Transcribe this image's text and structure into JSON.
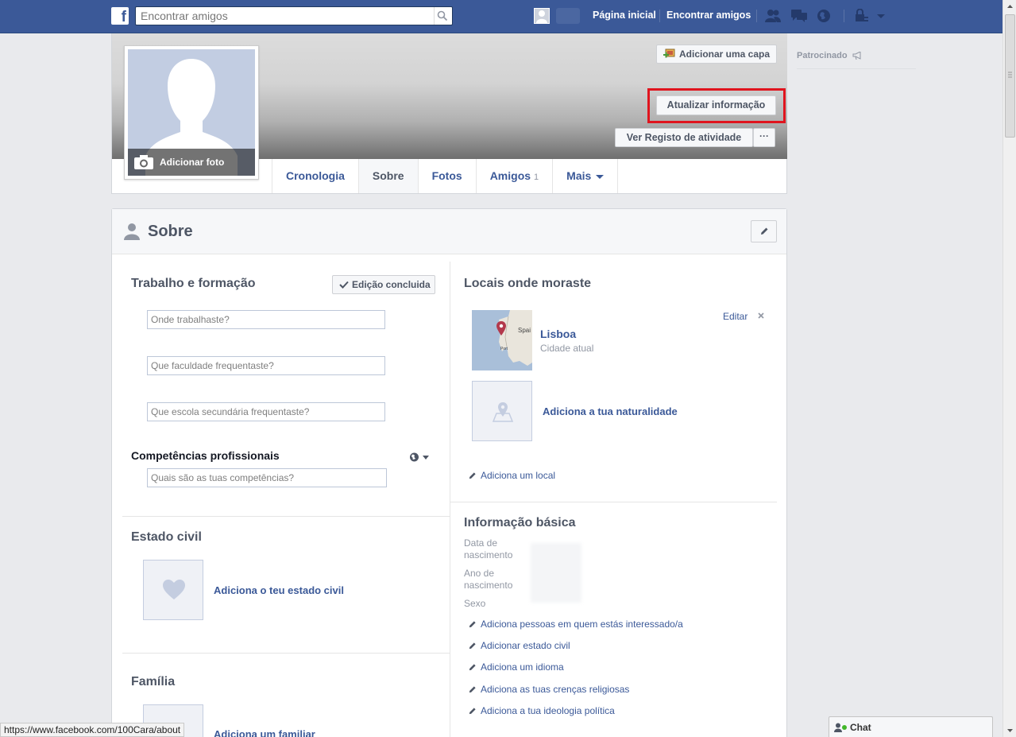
{
  "topbar": {
    "search_placeholder": "Encontrar amigos",
    "nav_home": "Página inicial",
    "nav_find_friends": "Encontrar amigos"
  },
  "cover": {
    "add_cover_label": "Adicionar uma capa",
    "update_info_label": "Atualizar informação",
    "activity_log_label": "Ver Registo de atividade",
    "more_label": "···",
    "add_photo_label": "Adicionar foto"
  },
  "tabs": [
    {
      "label": "Cronologia"
    },
    {
      "label": "Sobre"
    },
    {
      "label": "Fotos"
    },
    {
      "label": "Amigos",
      "count": "1"
    },
    {
      "label": "Mais"
    }
  ],
  "sidebar": {
    "sponsored_label": "Patrocinado"
  },
  "about": {
    "title": "Sobre",
    "work": {
      "title": "Trabalho e formação",
      "done_label": "Edição concluida",
      "work_placeholder": "Onde trabalhaste?",
      "college_placeholder": "Que faculdade frequentaste?",
      "highschool_placeholder": "Que escola secundária frequentaste?",
      "skills_title": "Competências profissionais",
      "skills_placeholder": "Quais são as tuas competências?"
    },
    "relationship": {
      "title": "Estado civil",
      "add_label": "Adiciona o teu estado civil"
    },
    "family": {
      "title": "Família",
      "add_label": "Adiciona um familiar"
    },
    "places": {
      "title": "Locais onde moraste",
      "city": "Lisboa",
      "city_sub": "Cidade atual",
      "edit_label": "Editar",
      "map_label_spain": "Spai",
      "map_label_port": "Port",
      "hometown_label": "Adiciona a tua naturalidade",
      "add_place_label": "Adiciona um local"
    },
    "basic": {
      "title": "Informação básica",
      "birth_date_label": "Data de nascimento",
      "birth_year_label": "Ano de nascimento",
      "sex_label": "Sexo",
      "links": [
        "Adiciona pessoas em quem estás interessado/a",
        "Adicionar estado civil",
        "Adiciona um idioma",
        "Adiciona as tuas crenças religiosas",
        "Adiciona a tua ideologia política"
      ]
    }
  },
  "status_bar": {
    "url": "https://www.facebook.com/100Cara/about"
  },
  "chat": {
    "label": "Chat"
  },
  "colors": {
    "brand_blue": "#3b5998",
    "highlight_red": "#e0141e"
  }
}
